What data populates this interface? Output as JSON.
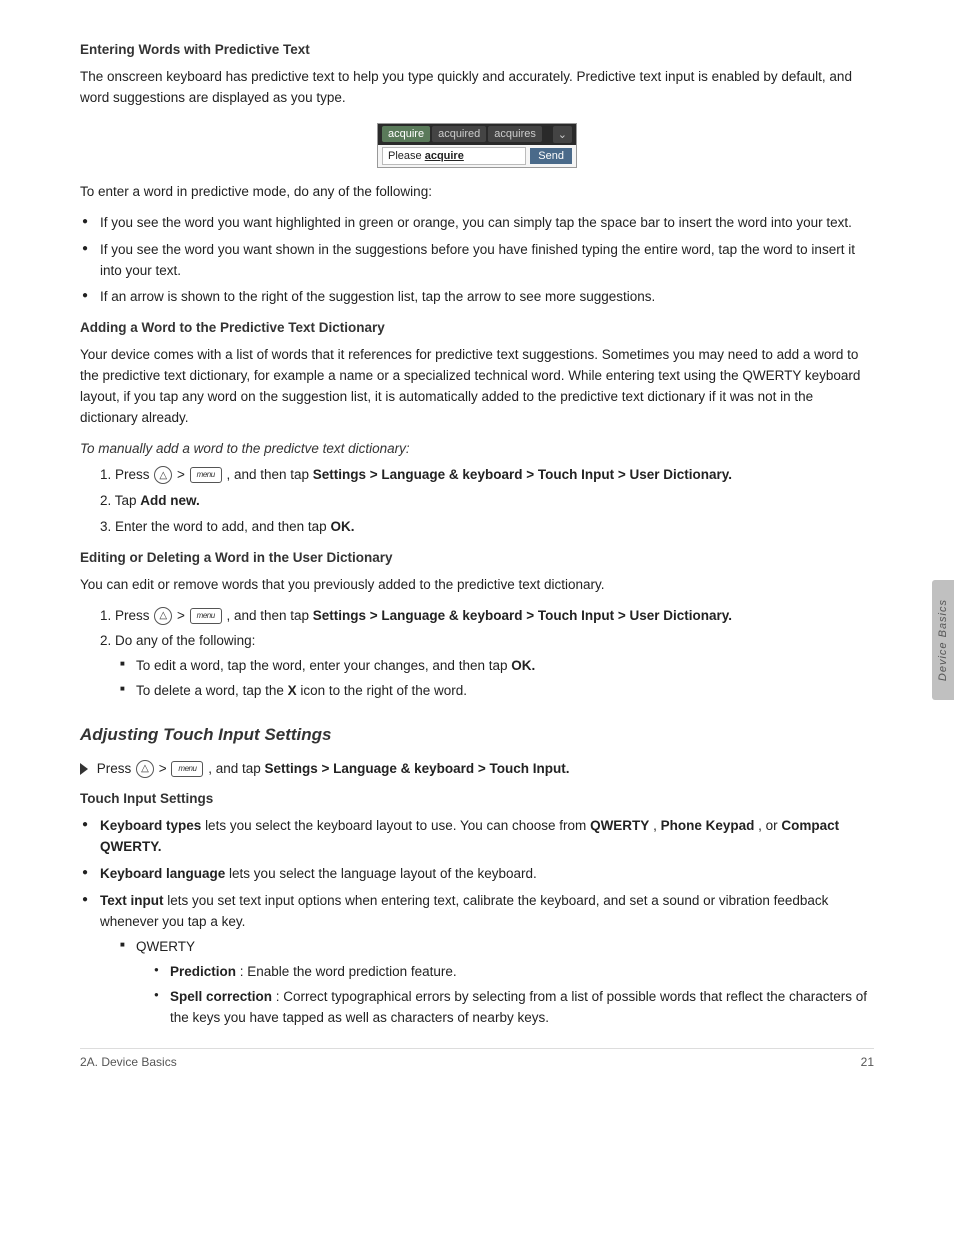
{
  "page": {
    "footer_left": "2A. Device Basics",
    "footer_right": "21",
    "side_tab": "Device Basics"
  },
  "sections": {
    "entering_words_title": "Entering Words with Predictive Text",
    "entering_words_body": "The onscreen keyboard has predictive text to help you type quickly and accurately. Predictive text input is enabled by default, and word suggestions are displayed as you type.",
    "entering_words_intro": "To enter a word in predictive mode, do any of the following:",
    "bullet1": "If you see the word you want highlighted in green or orange, you can simply tap the space bar to insert the word into your text.",
    "bullet2": "If you see the word you want shown in the suggestions before you have finished typing the entire word, tap the word to insert it into your text.",
    "bullet3": "If an arrow is shown to the right of the suggestion list, tap the arrow to see more suggestions.",
    "adding_word_title": "Adding a Word to the Predictive Text Dictionary",
    "adding_word_body": "Your device comes with a list of words that it references for predictive text suggestions. Sometimes you may need to add a word to the predictive text dictionary, for example a name or a specialized technical word. While entering text using the QWERTY keyboard layout, if you tap any word on the suggestion list, it is automatically added to the predictive text dictionary if it was not in the dictionary already.",
    "manual_add_title": "To manually add a word to the predictve text dictionary:",
    "step1_pre": "Press",
    "step1_mid": ">",
    "step1_post": ", and then tap",
    "step1_bold": "Settings > Language & keyboard > Touch Input > User Dictionary.",
    "step2_pre": "Tap",
    "step2_bold": "Add new.",
    "step3_pre": "Enter the word to add, and then tap",
    "step3_bold": "OK.",
    "editing_title": "Editing or Deleting a Word in the User Dictionary",
    "editing_body": "You can edit or remove words that you previously added to the predictive text dictionary.",
    "edit_step1_pre": "Press",
    "edit_step1_post": ", and then tap",
    "edit_step1_bold": "Settings > Language & keyboard > Touch Input > User Dictionary.",
    "edit_step2": "Do any of the following:",
    "edit_sub1_pre": "To edit a word, tap the word, enter your changes, and then tap",
    "edit_sub1_bold": "OK.",
    "edit_sub2_pre": "To delete a word, tap the",
    "edit_sub2_bold": "X",
    "edit_sub2_post": "icon to the right of the word.",
    "adjusting_title": "Adjusting Touch Input Settings",
    "adjusting_press_pre": "Press",
    "adjusting_press_mid": ">",
    "adjusting_press_post": ", and tap",
    "adjusting_press_bold": "Settings > Language & keyboard > Touch Input.",
    "touch_input_settings_title": "Touch Input Settings",
    "ts_bullet1_bold": "Keyboard types",
    "ts_bullet1_text": "lets you select the keyboard layout to use. You can choose from",
    "ts_bullet1_bold2": "QWERTY",
    "ts_bullet1_text2": ",",
    "ts_bullet1_bold3": "Phone Keypad",
    "ts_bullet1_text3": ",",
    "ts_bullet1_text4": "or",
    "ts_bullet1_bold4": "Compact QWERTY.",
    "ts_bullet2_bold": "Keyboard language",
    "ts_bullet2_text": "lets you select the language layout of the keyboard.",
    "ts_bullet3_bold": "Text input",
    "ts_bullet3_text": "lets you set text input options when entering text, calibrate the keyboard, and set a sound or vibration feedback whenever you tap a key.",
    "ts_sub1": "QWERTY",
    "ts_sub_sub1_bold": "Prediction",
    "ts_sub_sub1_text": ": Enable the word prediction feature.",
    "ts_sub_sub2_bold": "Spell correction",
    "ts_sub_sub2_text": ": Correct typographical errors by selecting from a list of possible words that reflect the characters of the keys you have tapped as well as characters of nearby keys.",
    "keyboard_suggestion": {
      "chips": [
        "acquire",
        "acquired",
        "acquires"
      ],
      "input_text": "Please acquire",
      "send_label": "Send"
    }
  }
}
